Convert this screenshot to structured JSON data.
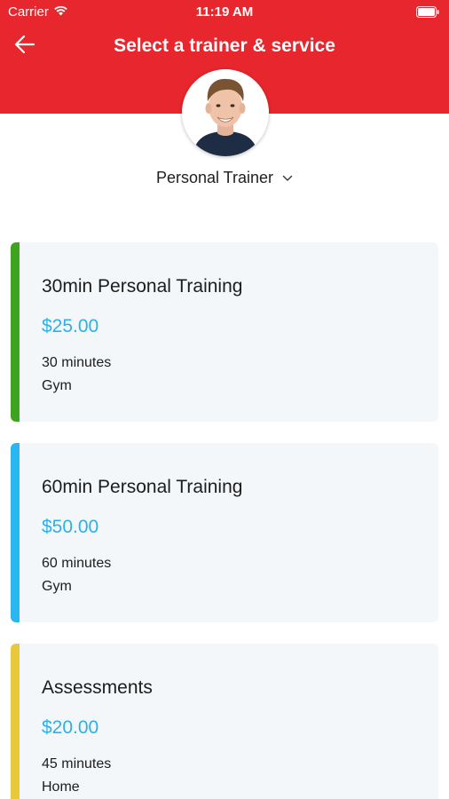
{
  "status_bar": {
    "carrier": "Carrier",
    "time": "11:19 AM"
  },
  "header": {
    "title": "Select a trainer & service",
    "background_color": "#e8262d"
  },
  "trainer": {
    "role": "Personal Trainer"
  },
  "services": [
    {
      "name": "30min Personal Training",
      "price": "$25.00",
      "duration": "30 minutes",
      "location": "Gym",
      "accent_color": "#3ea420"
    },
    {
      "name": "60min Personal Training",
      "price": "$50.00",
      "duration": "60 minutes",
      "location": "Gym",
      "accent_color": "#2ab6f0"
    },
    {
      "name": "Assessments",
      "price": "$20.00",
      "duration": "45 minutes",
      "location": "Home",
      "accent_color": "#e9c93c"
    }
  ],
  "icons": {
    "back": "arrow-left-icon",
    "dropdown": "chevron-down-icon",
    "wifi": "wifi-icon",
    "battery": "battery-icon"
  }
}
